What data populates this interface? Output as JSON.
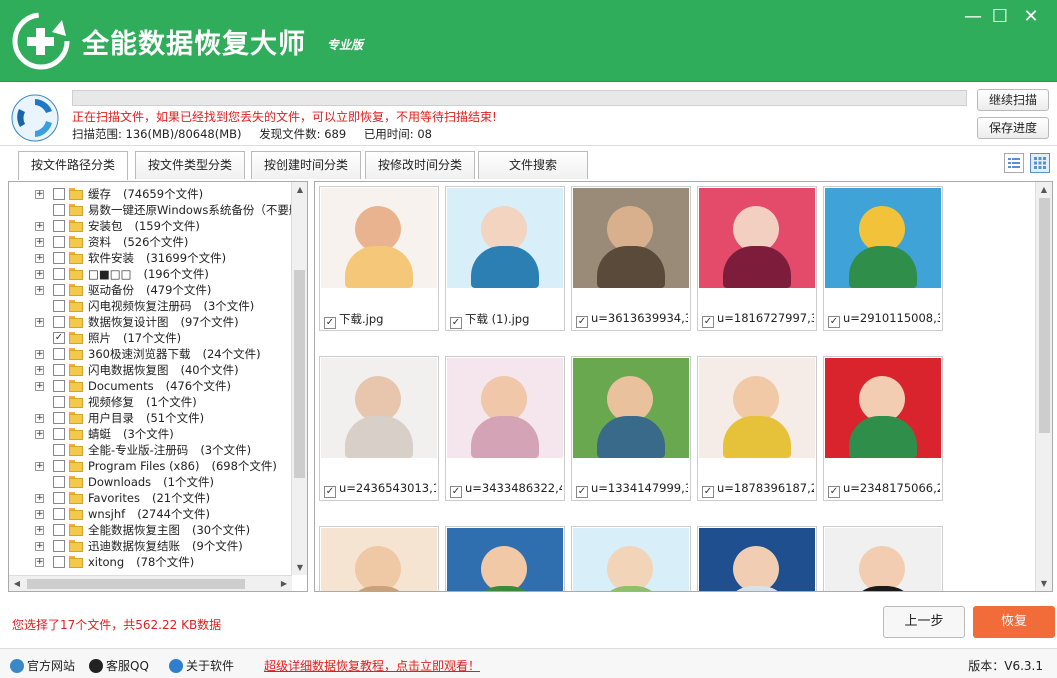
{
  "app": {
    "title": "全能数据恢复大师",
    "edition": "专业版",
    "colors": {
      "header": "#2fad5b",
      "accent": "#f26c3a",
      "alert": "#e02020"
    }
  },
  "window_controls": {
    "minimize": "—",
    "maximize": "☐",
    "close": "✕"
  },
  "scan": {
    "message": "正在扫描文件，如果已经找到您丢失的文件，可以立即恢复，不用等待扫描结束!",
    "range_label": "扫描范围: 136(MB)/80648(MB)",
    "found_label": "发现文件数: 689",
    "time_label": "已用时间: 08",
    "continue_button": "继续扫描",
    "save_button": "保存进度"
  },
  "tabs": [
    "按文件路径分类",
    "按文件类型分类",
    "按创建时间分类",
    "按修改时间分类",
    "文件搜索"
  ],
  "tree": [
    {
      "name": "缓存",
      "count": "(74659个文件)",
      "expandable": true,
      "checked": false
    },
    {
      "name": "易数一键还原Windows系统备份（不要删",
      "count": "",
      "expandable": false,
      "checked": false
    },
    {
      "name": "安装包",
      "count": "(159个文件)",
      "expandable": true,
      "checked": false
    },
    {
      "name": "资料",
      "count": "(526个文件)",
      "expandable": true,
      "checked": false
    },
    {
      "name": "软件安装",
      "count": "(31699个文件)",
      "expandable": true,
      "checked": false
    },
    {
      "name": "□■□□",
      "count": "(196个文件)",
      "expandable": true,
      "checked": false
    },
    {
      "name": "驱动备份",
      "count": "(479个文件)",
      "expandable": true,
      "checked": false
    },
    {
      "name": "闪电视频恢复注册码",
      "count": "(3个文件)",
      "expandable": false,
      "checked": false
    },
    {
      "name": "数据恢复设计图",
      "count": "(97个文件)",
      "expandable": true,
      "checked": false
    },
    {
      "name": "照片",
      "count": "(17个文件)",
      "expandable": false,
      "checked": true
    },
    {
      "name": "360极速浏览器下载",
      "count": "(24个文件)",
      "expandable": true,
      "checked": false
    },
    {
      "name": "闪电数据恢复图",
      "count": "(40个文件)",
      "expandable": true,
      "checked": false
    },
    {
      "name": "Documents",
      "count": "(476个文件)",
      "expandable": true,
      "checked": false
    },
    {
      "name": "视频修复",
      "count": "(1个文件)",
      "expandable": false,
      "checked": false
    },
    {
      "name": "用户目录",
      "count": "(51个文件)",
      "expandable": true,
      "checked": false
    },
    {
      "name": "蜻蜓",
      "count": "(3个文件)",
      "expandable": true,
      "checked": false
    },
    {
      "name": "全能-专业版-注册码",
      "count": "(3个文件)",
      "expandable": false,
      "checked": false
    },
    {
      "name": "Program Files (x86)",
      "count": "(698个文件)",
      "expandable": true,
      "checked": false
    },
    {
      "name": "Downloads",
      "count": "(1个文件)",
      "expandable": false,
      "checked": false
    },
    {
      "name": "Favorites",
      "count": "(21个文件)",
      "expandable": true,
      "checked": false
    },
    {
      "name": "wnsjhf",
      "count": "(2744个文件)",
      "expandable": true,
      "checked": false
    },
    {
      "name": "全能数据恢复主图",
      "count": "(30个文件)",
      "expandable": true,
      "checked": false
    },
    {
      "name": "迅迪数据恢复结账",
      "count": "(9个文件)",
      "expandable": true,
      "checked": false
    },
    {
      "name": "xitong",
      "count": "(78个文件)",
      "expandable": true,
      "checked": false
    }
  ],
  "files": [
    {
      "name": "下载.jpg",
      "checked": true,
      "colors": [
        "#f7f2ee",
        "#e9b38f",
        "#f4c878"
      ]
    },
    {
      "name": "下载 (1).jpg",
      "checked": true,
      "colors": [
        "#d8eef8",
        "#f2d4c0",
        "#2c7fb3"
      ]
    },
    {
      "name": "u=3613639934,3...",
      "checked": true,
      "colors": [
        "#9a8a78",
        "#d9b08e",
        "#5a4a3a"
      ]
    },
    {
      "name": "u=1816727997,3...",
      "checked": true,
      "colors": [
        "#e44a6a",
        "#f3cfc1",
        "#7d1d3b"
      ]
    },
    {
      "name": "u=2910115008,3...",
      "checked": true,
      "colors": [
        "#3fa3d8",
        "#f2c23a",
        "#2f8f4a"
      ]
    },
    {
      "name": "u=2436543013,1...",
      "checked": true,
      "colors": [
        "#f2f0ee",
        "#e8c6ae",
        "#d7cfc8"
      ]
    },
    {
      "name": "u=3433486322,4...",
      "checked": true,
      "colors": [
        "#f4e6ec",
        "#f0c7a8",
        "#d4a3b6"
      ]
    },
    {
      "name": "u=1334147999,3...",
      "checked": true,
      "colors": [
        "#6aa84f",
        "#e9c19d",
        "#3a6a8a"
      ]
    },
    {
      "name": "u=1878396187,2...",
      "checked": true,
      "colors": [
        "#f5ece8",
        "#f2c9a6",
        "#e6c23a"
      ]
    },
    {
      "name": "u=2348175066,2...",
      "checked": true,
      "colors": [
        "#d9232d",
        "#f2cdb2",
        "#2f8f4a"
      ]
    },
    {
      "name": "",
      "checked": false,
      "colors": [
        "#f5e4d2",
        "#efc8a6",
        "#c9a27a"
      ]
    },
    {
      "name": "",
      "checked": false,
      "colors": [
        "#2f6fb0",
        "#f2c9a6",
        "#3a8a3a"
      ]
    },
    {
      "name": "",
      "checked": false,
      "colors": [
        "#d8eef8",
        "#f2d4b8",
        "#8fbf6a"
      ]
    },
    {
      "name": "",
      "checked": false,
      "colors": [
        "#1f4f8f",
        "#f0cdb3",
        "#d8e2ea"
      ]
    },
    {
      "name": "",
      "checked": false,
      "colors": [
        "#f0f0f0",
        "#f2cdb2",
        "#1a1a1a"
      ]
    }
  ],
  "selection_text": "您选择了17个文件，共562.22 KB数据",
  "buttons": {
    "back": "上一步",
    "recover": "恢复"
  },
  "footer": {
    "website": "官方网站",
    "qq": "客服QQ",
    "about": "关于软件",
    "tutorial": "超级详细数据恢复教程，点击立即观看！",
    "version_label": "版本：",
    "version": "V6.3.1"
  },
  "icons": {
    "logo": "plus-recycle-icon",
    "scan": "recycle-arrows-icon",
    "list_view": "list-view-icon",
    "thumb_view": "grid-view-icon"
  }
}
